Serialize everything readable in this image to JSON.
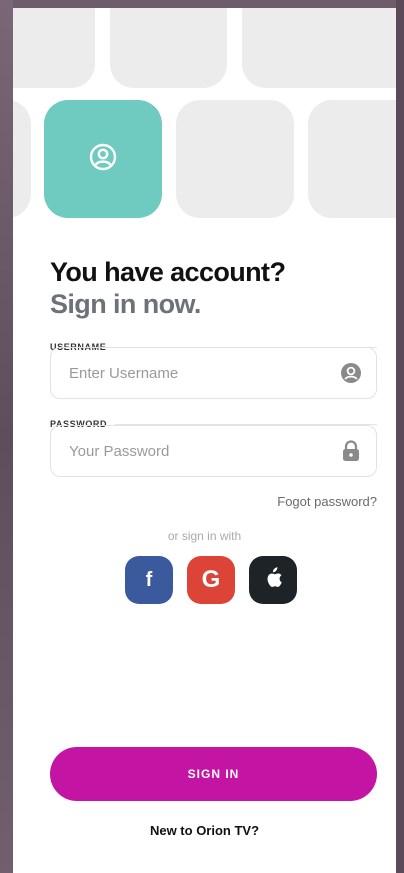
{
  "heading": {
    "line1": "You have account?",
    "line2": "Sign in now."
  },
  "username": {
    "label": "USERNAME",
    "placeholder": "Enter Username",
    "icon": "user-circle-icon"
  },
  "password": {
    "label": "PASSWORD",
    "placeholder": "Your Password",
    "icon": "lock-icon"
  },
  "forgot_label": "Fogot password?",
  "or_text": "or sign in with",
  "social": {
    "facebook": "f",
    "google": "G",
    "apple_icon": "apple-icon"
  },
  "signin_label": "SIGN IN",
  "new_user_label": "New to Orion TV?",
  "colors": {
    "accent": "#c414a3",
    "teal": "#6fcbbf",
    "facebook": "#3b5a9d",
    "google": "#db4437",
    "apple": "#1e2327"
  }
}
